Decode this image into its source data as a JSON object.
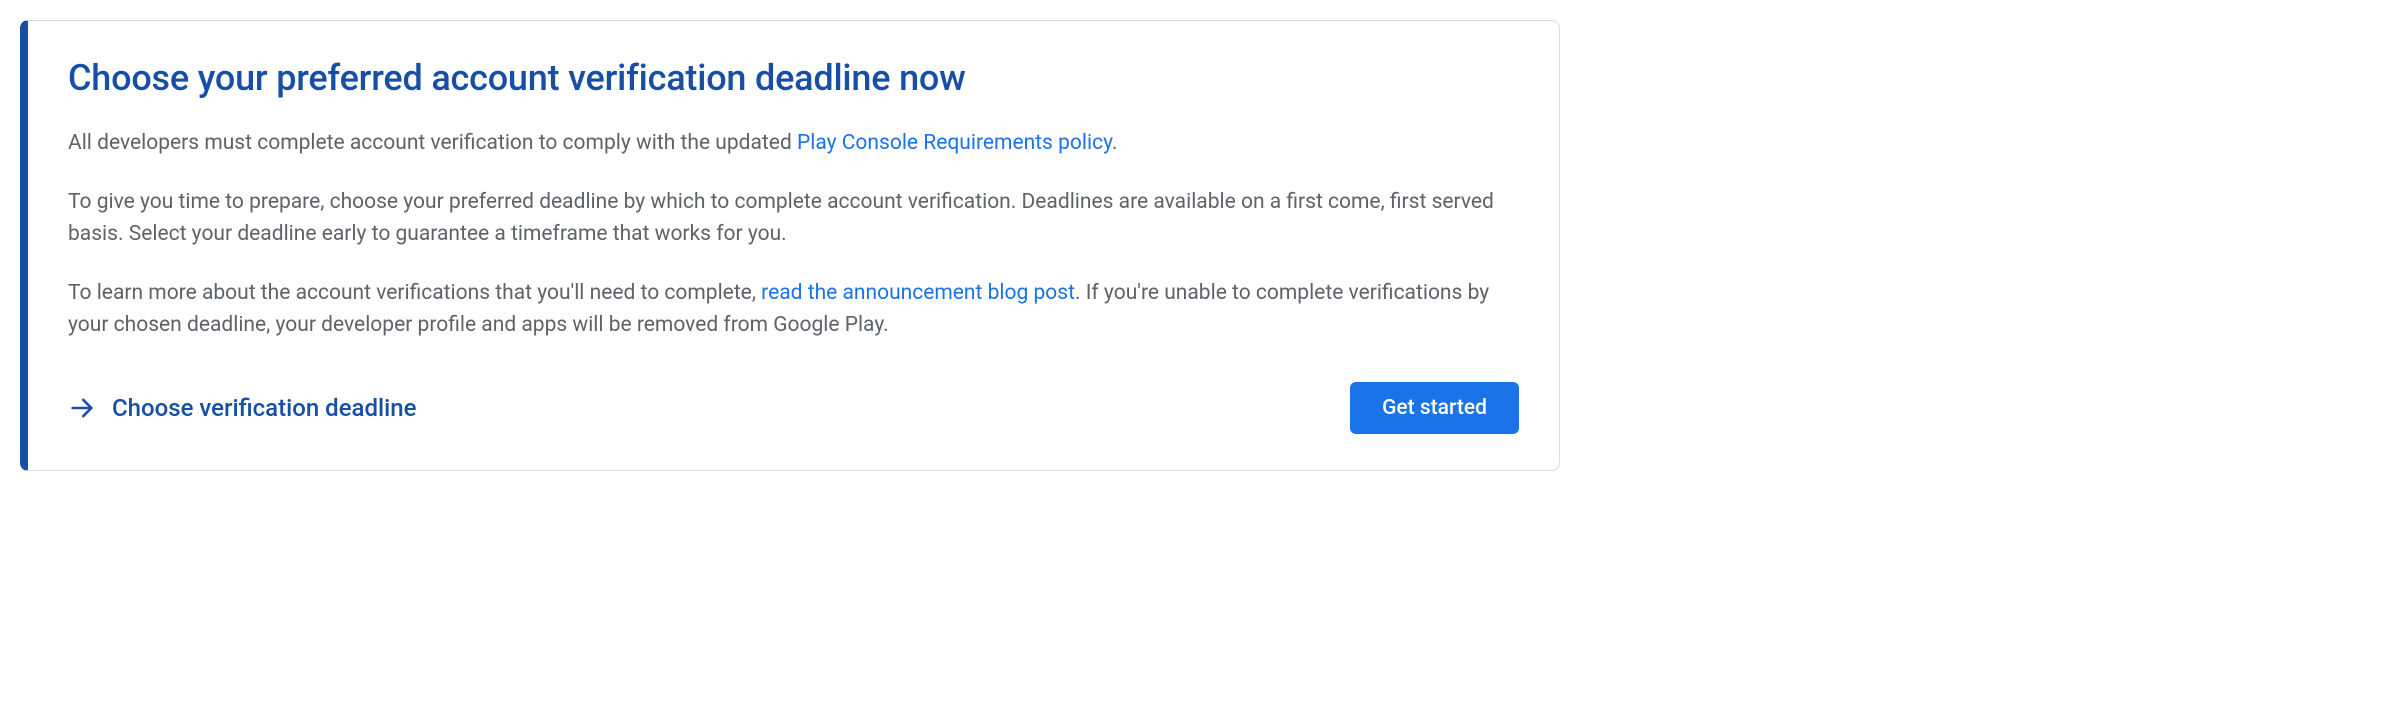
{
  "card": {
    "title": "Choose your preferred account verification deadline now",
    "para1_prefix": "All developers must complete account verification to comply with the updated ",
    "para1_link": "Play Console Requirements policy",
    "para1_suffix": ".",
    "para2": "To give you time to prepare, choose your preferred deadline by which to complete account verification. Deadlines are available on a first come, first served basis. Select your deadline early to guarantee a timeframe that works for you.",
    "para3_prefix": "To learn more about the account verifications that you'll need to complete, ",
    "para3_link": "read the announcement blog post",
    "para3_suffix": ". If you're unable to complete verifications by your chosen deadline, your developer profile and apps will be removed from Google Play.",
    "action_link_label": "Choose verification deadline",
    "primary_button_label": "Get started"
  }
}
